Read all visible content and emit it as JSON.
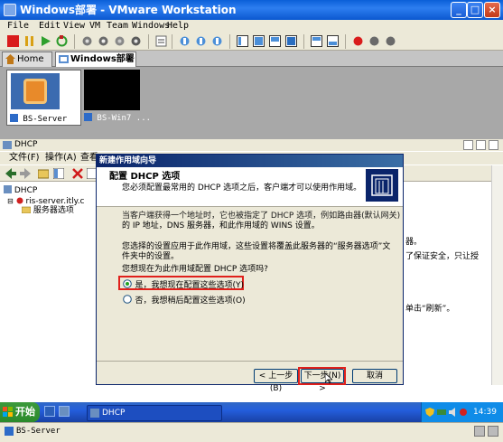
{
  "vmware": {
    "title": "Windows部署 - VMware Workstation",
    "menu": [
      "File",
      "Edit",
      "View",
      "VM",
      "Team",
      "Windows",
      "Help"
    ],
    "window_buttons": [
      "_",
      "□",
      "×"
    ],
    "tabs": [
      {
        "label": "Home",
        "icon": "home-icon"
      },
      {
        "label": "Windows部署",
        "icon": "team-icon",
        "close": "×"
      }
    ],
    "thumbnails": [
      {
        "label": "BS-Server",
        "active": true
      },
      {
        "label": "BS-Win7 ..."
      }
    ],
    "status_label": "BS-Server"
  },
  "guest": {
    "dhcp_title": "DHCP",
    "dhcp_menu": [
      "文件(F)",
      "操作(A)",
      "查看"
    ],
    "tree": {
      "root": "DHCP",
      "server": "ris-server.itly.c",
      "child": "服务器选项"
    },
    "right_pane_text": [
      "器。",
      "了保证安全，只让授",
      "单击“刷新”。"
    ],
    "taskbar": {
      "start_label": "开始",
      "task_item": "DHCP",
      "clock": "14:39"
    }
  },
  "wizard": {
    "title": "新建作用域向导",
    "header_title": "配置 DHCP 选项",
    "header_subtitle": "您必须配置最常用的 DHCP 选项之后，客户端才可以使用作用域。",
    "para1_line1": "当客户端获得一个地址时，它也被指定了 DHCP 选项，例如路由器(默认网关)",
    "para1_line2": "的 IP 地址，DNS 服务器，和此作用域的 WINS 设置。",
    "para2_line1": "您选择的设置应用于此作用域，这些设置将覆盖此服务器的“服务器选项”文",
    "para2_line2": "件夹中的设置。",
    "question": "您想现在为此作用域配置 DHCP 选项吗?",
    "option_yes": "是，我想现在配置这些选项(Y)",
    "option_no": "否，我想稍后配置这些选项(O)",
    "selected_option": "yes",
    "back_button": "< 上一步(B)",
    "next_button": "下一步(N) >",
    "cancel_button": "取消"
  },
  "colors": {
    "highlight_red": "#e0201b",
    "title_blue": "#0a5fd8",
    "wizard_title": "#0a246a"
  }
}
